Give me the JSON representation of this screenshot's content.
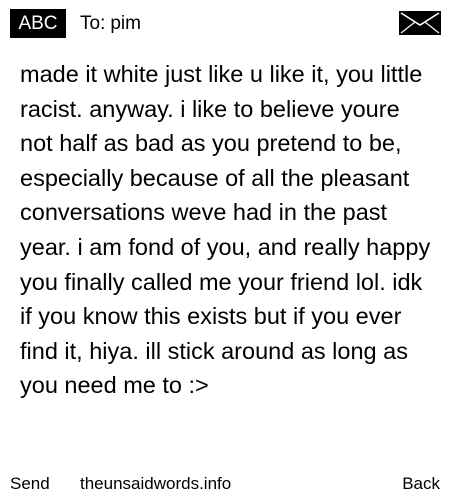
{
  "header": {
    "mode_badge": "ABC",
    "to_label": "To:",
    "recipient": "pim",
    "envelope_icon": "envelope-icon"
  },
  "message": {
    "body": "made it white just like u like it, you little racist. anyway. i like to believe youre not half as bad as you pretend to be, especially because of all the pleasant conversations weve had in the past year. i am fond of you, and really happy you finally called me your friend lol. idk if you know this exists but if you ever find it, hiya. ill stick around as long as you need me to :>"
  },
  "footer": {
    "left_softkey": "Send",
    "site": "theunsaidwords.info",
    "right_softkey": "Back"
  },
  "colors": {
    "background": "#ffffff",
    "text": "#000000",
    "badge_background": "#000000",
    "badge_text": "#ffffff"
  }
}
